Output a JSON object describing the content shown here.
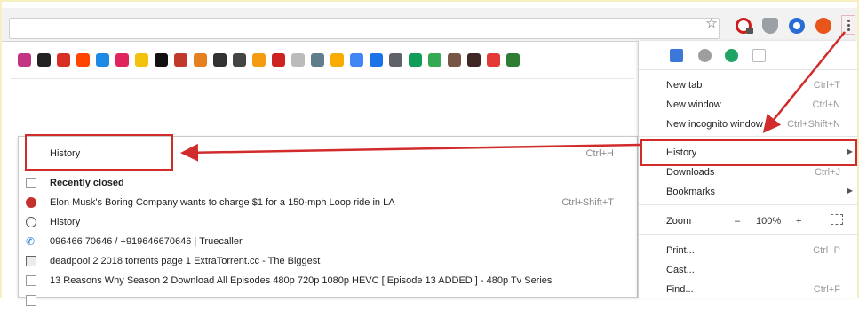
{
  "toolbar": {
    "star_glyph": "☆",
    "extensions": [
      "opera-ad-blocker-icon",
      "shield-extension-icon",
      "blue-circle-extension-icon",
      "fire-extension-icon"
    ]
  },
  "bookmarks_bar": {
    "icons": [
      {
        "name": "instagram-icon",
        "color": "#c13584"
      },
      {
        "name": "camera-icon",
        "color": "#222222"
      },
      {
        "name": "gmail-icon",
        "color": "#d93025"
      },
      {
        "name": "reddit-icon",
        "color": "#ff4500"
      },
      {
        "name": "upload-icon",
        "color": "#1e88e5"
      },
      {
        "name": "red-app-icon",
        "color": "#e0245e"
      },
      {
        "name": "yellow-notes-icon",
        "color": "#f4c20d"
      },
      {
        "name": "b-letter-icon",
        "color": "#111111"
      },
      {
        "name": "wordpress-icon",
        "color": "#c0392b"
      },
      {
        "name": "swirl-icon",
        "color": "#e67e22"
      },
      {
        "name": "t-letter-icon",
        "color": "#333333"
      },
      {
        "name": "spotify-like-icon",
        "color": "#444444"
      },
      {
        "name": "orange-globe-icon",
        "color": "#f39c12"
      },
      {
        "name": "red-tool-icon",
        "color": "#cc2222"
      },
      {
        "name": "blank-page-icon",
        "color": "#bbbbbb"
      },
      {
        "name": "doc-icon",
        "color": "#607d8b"
      },
      {
        "name": "analytics-icon",
        "color": "#f9ab00"
      },
      {
        "name": "google-icon",
        "color": "#4285f4"
      },
      {
        "name": "trend-icon",
        "color": "#1a73e8"
      },
      {
        "name": "bank-icon",
        "color": "#5f6368"
      },
      {
        "name": "drive-icon",
        "color": "#0f9d58"
      },
      {
        "name": "green-arrow-icon",
        "color": "#34a853"
      },
      {
        "name": "cart-icon",
        "color": "#795548"
      },
      {
        "name": "dark-book-icon",
        "color": "#3e2723"
      },
      {
        "name": "video-icon",
        "color": "#e53935"
      },
      {
        "name": "green-knot-icon",
        "color": "#2e7d32"
      }
    ]
  },
  "history_submenu": {
    "header": {
      "label": "History",
      "shortcut": "Ctrl+H"
    },
    "recently_closed": "Recently closed",
    "items": [
      {
        "icon": "tesla-red-icon",
        "label": "Elon Musk's Boring Company wants to charge $1 for a 150-mph Loop ride in LA",
        "shortcut": "Ctrl+Shift+T"
      },
      {
        "icon": "history-clock-icon",
        "label": "History",
        "shortcut": ""
      },
      {
        "icon": "phone-icon",
        "label": "096466 70646 / +919646670646 | Truecaller",
        "shortcut": ""
      },
      {
        "icon": "torrent-page-icon",
        "label": "deadpool 2 2018 torrents page 1 ExtraTorrent.cc - The Biggest",
        "shortcut": ""
      },
      {
        "icon": "blank-page-icon",
        "label": "13 Reasons Why Season 2 Download All Episodes 480p 720p 1080p HEVC [ Episode 13 ADDED ] - 480p Tv Series",
        "shortcut": ""
      }
    ]
  },
  "main_menu": {
    "items": [
      {
        "label": "New tab",
        "shortcut": "Ctrl+T"
      },
      {
        "label": "New window",
        "shortcut": "Ctrl+N"
      },
      {
        "label": "New incognito window",
        "shortcut": "Ctrl+Shift+N"
      },
      {
        "label": "History",
        "shortcut": ""
      },
      {
        "label": "Downloads",
        "shortcut": "Ctrl+J"
      },
      {
        "label": "Bookmarks",
        "shortcut": ""
      }
    ],
    "zoom": {
      "label": "Zoom",
      "minus": "–",
      "value": "100%",
      "plus": "+"
    },
    "items_lower": [
      {
        "label": "Print...",
        "shortcut": "Ctrl+P"
      },
      {
        "label": "Cast...",
        "shortcut": ""
      },
      {
        "label": "Find...",
        "shortcut": "Ctrl+F"
      }
    ]
  },
  "colors": {
    "highlight": "#d22b2b",
    "menu_border": "#c9c9c9"
  }
}
